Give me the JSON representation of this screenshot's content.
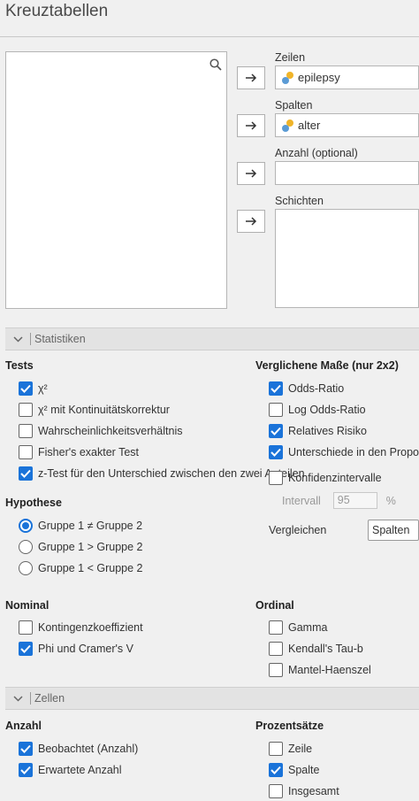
{
  "title": "Kreuztabellen",
  "fields": {
    "zeilen": {
      "label": "Zeilen",
      "value": "epilepsy"
    },
    "spalten": {
      "label": "Spalten",
      "value": "alter"
    },
    "anzahl": {
      "label": "Anzahl (optional)",
      "value": ""
    },
    "schichten": {
      "label": "Schichten"
    }
  },
  "statistiken": {
    "header": "Statistiken",
    "tests": {
      "heading": "Tests",
      "items": [
        {
          "label": "χ²",
          "checked": true
        },
        {
          "label": "χ² mit Kontinuitätskorrektur",
          "checked": false
        },
        {
          "label": "Wahrscheinlichkeitsverhältnis",
          "checked": false
        },
        {
          "label": "Fisher's exakter Test",
          "checked": false
        },
        {
          "label": "z-Test für den Unterschied zwischen den zwei Anteilen",
          "checked": true
        }
      ]
    },
    "vergleiche": {
      "heading": "Verglichene Maße (nur 2x2)",
      "items": [
        {
          "label": "Odds-Ratio",
          "checked": true
        },
        {
          "label": "Log Odds-Ratio",
          "checked": false
        },
        {
          "label": "Relatives Risiko",
          "checked": true
        },
        {
          "label": "Unterschiede in den Proportionen",
          "checked": true
        }
      ],
      "ci": {
        "label": "Konfidenzintervalle",
        "checked": false
      },
      "intervall": {
        "label": "Intervall",
        "value": "95",
        "unit": "%"
      },
      "vergleichen": {
        "label": "Vergleichen",
        "value": "Spalten"
      }
    },
    "hypothese": {
      "heading": "Hypothese",
      "options": [
        {
          "label": "Gruppe 1 ≠ Gruppe 2",
          "selected": true
        },
        {
          "label": "Gruppe 1 > Gruppe 2",
          "selected": false
        },
        {
          "label": "Gruppe 1 < Gruppe 2",
          "selected": false
        }
      ]
    },
    "nominal": {
      "heading": "Nominal",
      "items": [
        {
          "label": "Kontingenzkoeffizient",
          "checked": false
        },
        {
          "label": "Phi und Cramer's V",
          "checked": true
        }
      ]
    },
    "ordinal": {
      "heading": "Ordinal",
      "items": [
        {
          "label": "Gamma",
          "checked": false
        },
        {
          "label": "Kendall's Tau-b",
          "checked": false
        },
        {
          "label": "Mantel-Haenszel",
          "checked": false
        }
      ]
    }
  },
  "zellen": {
    "header": "Zellen",
    "anzahl": {
      "heading": "Anzahl",
      "items": [
        {
          "label": "Beobachtet (Anzahl)",
          "checked": true
        },
        {
          "label": "Erwartete Anzahl",
          "checked": true
        }
      ]
    },
    "prozent": {
      "heading": "Prozentsätze",
      "items": [
        {
          "label": "Zeile",
          "checked": false
        },
        {
          "label": "Spalte",
          "checked": true
        },
        {
          "label": "Insgesamt",
          "checked": false
        }
      ]
    }
  }
}
